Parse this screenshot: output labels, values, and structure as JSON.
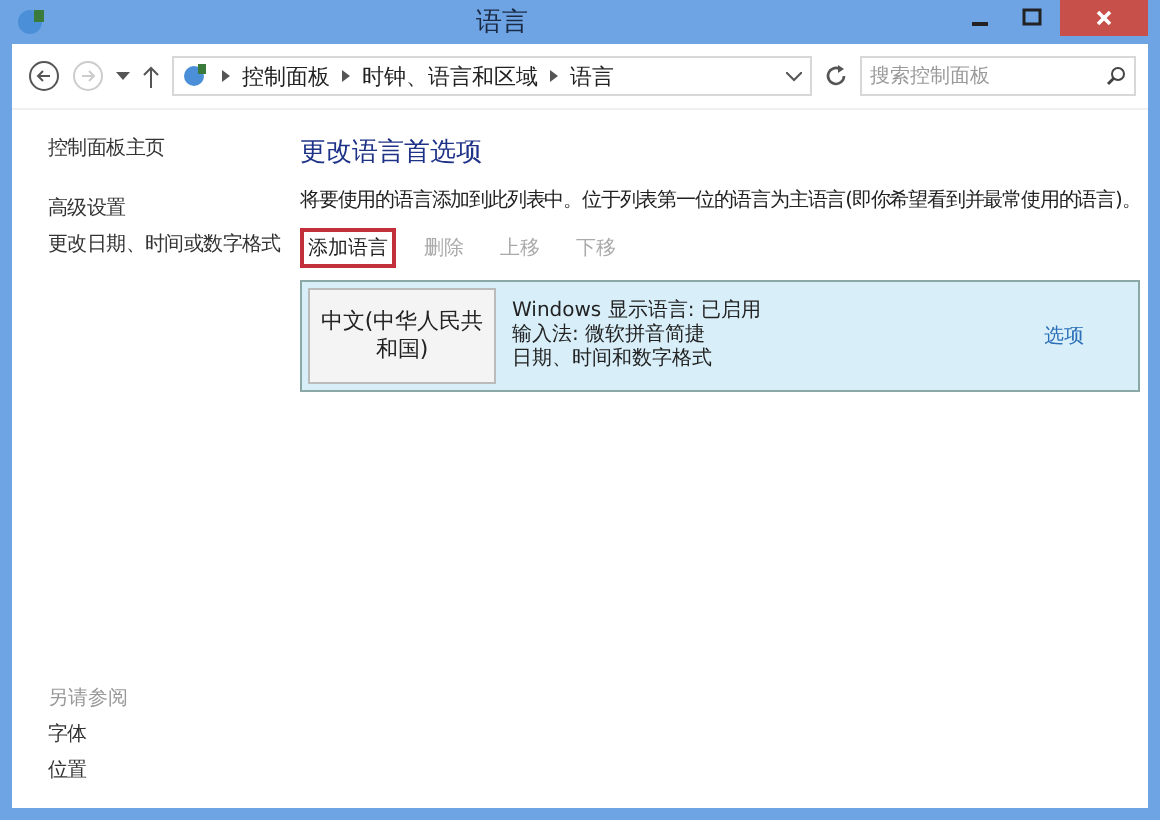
{
  "window": {
    "title": "语言"
  },
  "address_bar": {
    "path": [
      "控制面板",
      "时钟、语言和区域",
      "语言"
    ]
  },
  "search": {
    "placeholder": "搜索控制面板"
  },
  "sidebar": {
    "links": [
      "控制面板主页",
      "高级设置",
      "更改日期、时间或数字格式"
    ],
    "see_also": {
      "heading": "另请参阅",
      "links": [
        "字体",
        "位置"
      ]
    }
  },
  "main": {
    "heading": "更改语言首选项",
    "description": "将要使用的语言添加到此列表中。位于列表第一位的语言为主语言(即你希望看到并最常使用的语言)。",
    "toolbar": [
      {
        "label": "添加语言",
        "disabled": false,
        "highlighted": true
      },
      {
        "label": "删除",
        "disabled": true,
        "highlighted": false
      },
      {
        "label": "上移",
        "disabled": true,
        "highlighted": false
      },
      {
        "label": "下移",
        "disabled": true,
        "highlighted": false
      }
    ],
    "languages": [
      {
        "name": "中文(中华人民共和国)",
        "selected": true,
        "details": [
          "Windows 显示语言: 已启用",
          "输入法: 微软拼音简捷",
          "日期、时间和数字格式"
        ],
        "options": "选项"
      }
    ]
  }
}
